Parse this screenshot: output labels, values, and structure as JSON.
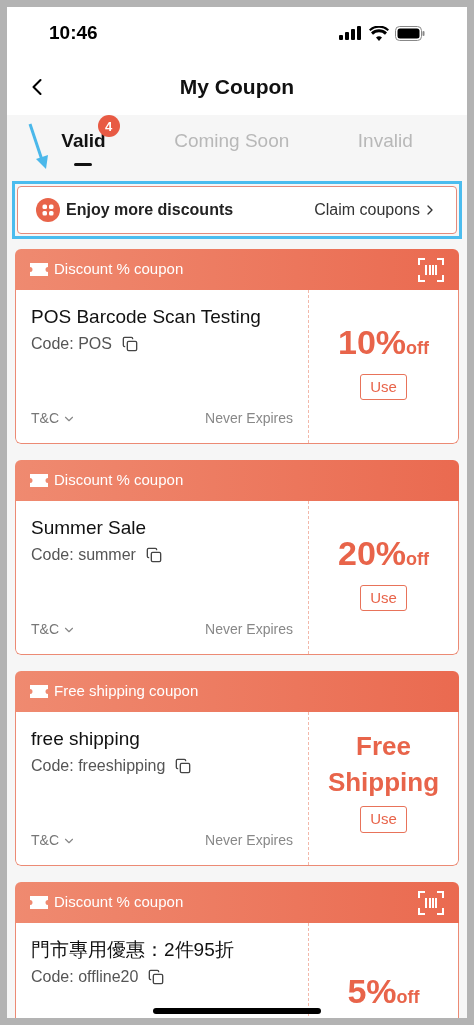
{
  "status_bar": {
    "time": "10:46"
  },
  "header": {
    "title": "My Coupon"
  },
  "tabs": [
    {
      "label": "Valid",
      "selected": true,
      "badge": "4"
    },
    {
      "label": "Coming Soon",
      "selected": false
    },
    {
      "label": "Invalid",
      "selected": false
    }
  ],
  "banner": {
    "text": "Enjoy more discounts",
    "link": "Claim coupons",
    "highlighted": true
  },
  "coupons": [
    {
      "kind": "discount",
      "type_label": "Discount % coupon",
      "barcode": true,
      "title": "POS Barcode Scan Testing",
      "code": "Code: POS",
      "amount": "10%",
      "suffix": "off",
      "button": "Use",
      "terms": "T&C",
      "expiry": "Never Expires"
    },
    {
      "kind": "discount",
      "type_label": "Discount % coupon",
      "barcode": false,
      "title": "Summer Sale",
      "code": "Code: summer",
      "amount": "20%",
      "suffix": "off",
      "button": "Use",
      "terms": "T&C",
      "expiry": "Never Expires"
    },
    {
      "kind": "shipping",
      "type_label": "Free shipping coupon",
      "barcode": false,
      "title": "free shipping",
      "code": "Code: freeshipping",
      "amount": "Free Shipping",
      "button": "Use",
      "terms": "T&C",
      "expiry": "Never Expires"
    },
    {
      "kind": "discount",
      "type_label": "Discount % coupon",
      "barcode": true,
      "title": "門市專用優惠：2件95折",
      "code": "Code: offline20",
      "amount": "5%",
      "suffix": "off"
    }
  ]
}
